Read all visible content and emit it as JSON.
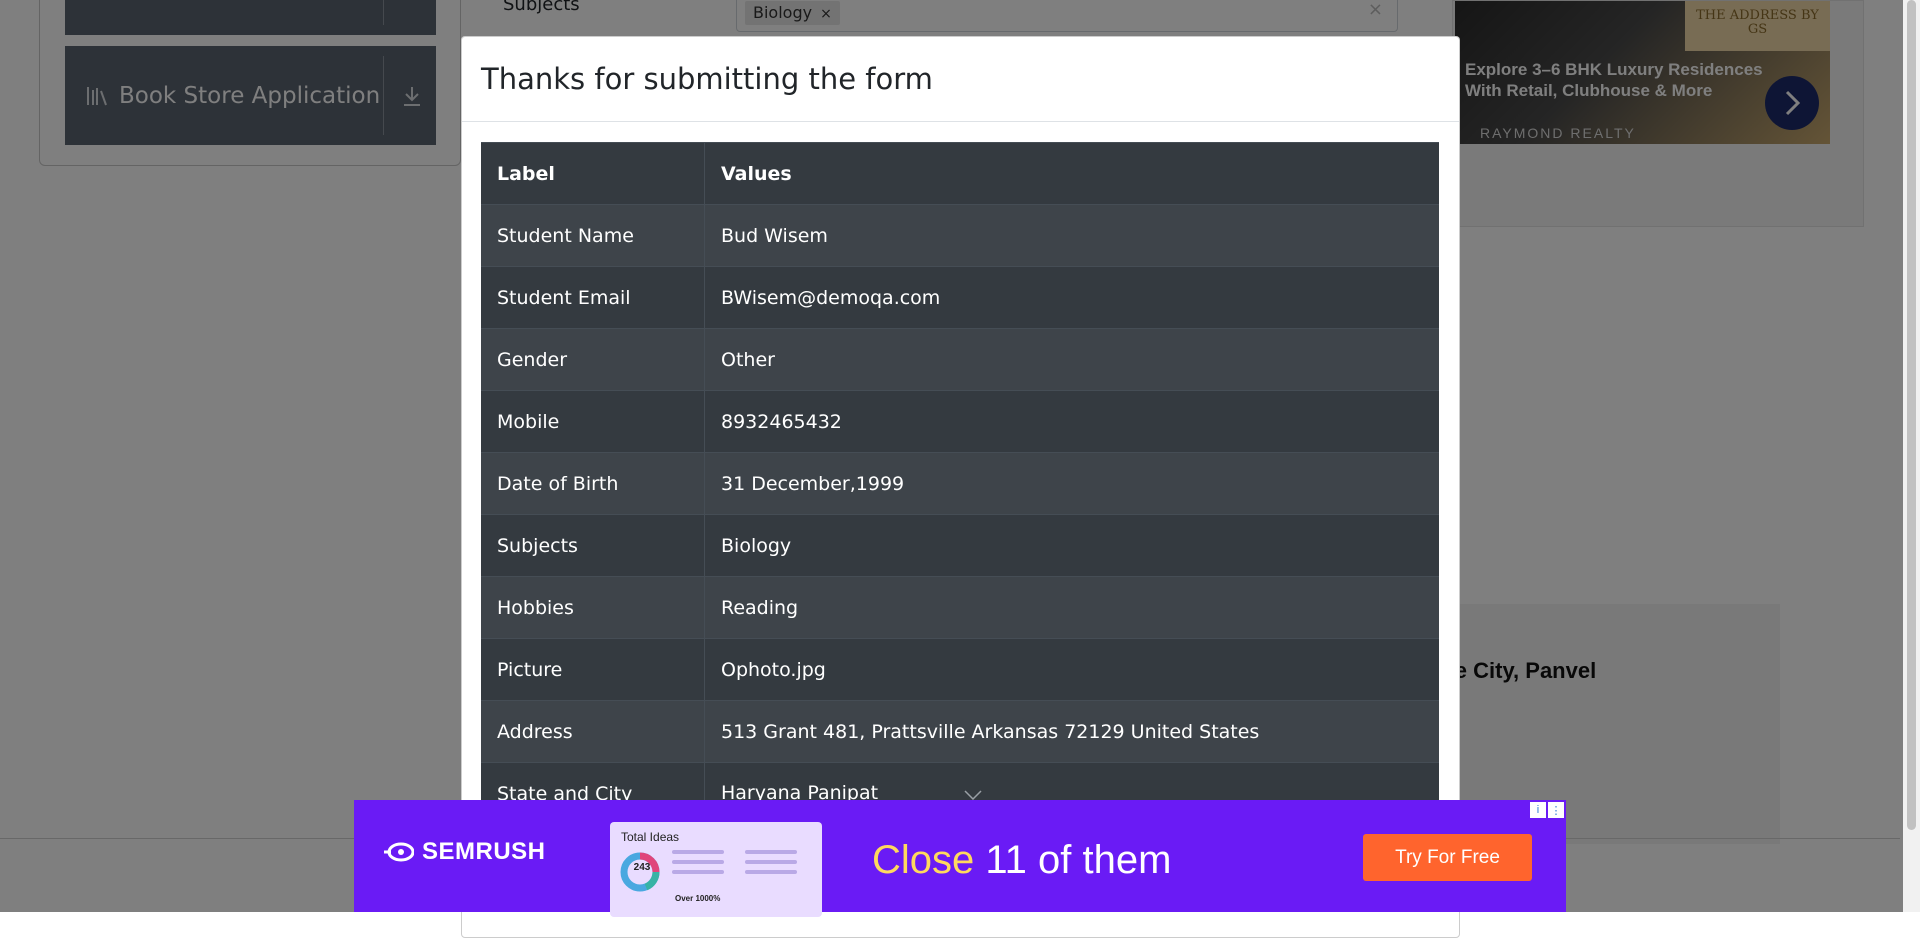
{
  "background": {
    "sidebar_buttons": [
      {
        "label": ""
      },
      {
        "label": "Book Store Application"
      }
    ],
    "form": {
      "subjects_label": "Subjects",
      "subjects_chip": "Biology",
      "chip_remove": "×",
      "clear_all": "×"
    },
    "right_ad": {
      "brand_badge": "THE ADDRESS BY GS",
      "text": "Explore 3–6 BHK Luxury Residences With Retail, Clubhouse & More",
      "brand": "RAYMOND REALTY"
    },
    "lower_ad_text": "rtune City, Panvel"
  },
  "modal": {
    "title": "Thanks for submitting the form",
    "table": {
      "headers": [
        "Label",
        "Values"
      ],
      "rows": [
        {
          "label": "Student Name",
          "value": "Bud Wisem"
        },
        {
          "label": "Student Email",
          "value": "BWisem@demoqa.com"
        },
        {
          "label": "Gender",
          "value": "Other"
        },
        {
          "label": "Mobile",
          "value": "8932465432"
        },
        {
          "label": "Date of Birth",
          "value": "31 December,1999"
        },
        {
          "label": "Subjects",
          "value": "Biology"
        },
        {
          "label": "Hobbies",
          "value": "Reading"
        },
        {
          "label": "Picture",
          "value": "Ophoto.jpg"
        },
        {
          "label": "Address",
          "value": "513 Grant 481, Prattsville Arkansas 72129 United States"
        },
        {
          "label": "State and City",
          "value": "Haryana Panipat"
        }
      ]
    }
  },
  "bottom_ad": {
    "logo": "SEMRUSH",
    "card_title": "Total Ideas",
    "card_count": "243",
    "card_foot": "Over 1000%",
    "headline_accent": "Close",
    "headline_rest": " 11 of them",
    "cta": "Try For Free",
    "info_icon": "i",
    "menu_icon": "⋮"
  },
  "colors": {
    "table_dark": "#343a40",
    "table_stripe": "#3e444a",
    "ad_purple": "#6a1bf5",
    "ad_cta": "#ff642d",
    "ad_accent": "#ffd95e"
  }
}
